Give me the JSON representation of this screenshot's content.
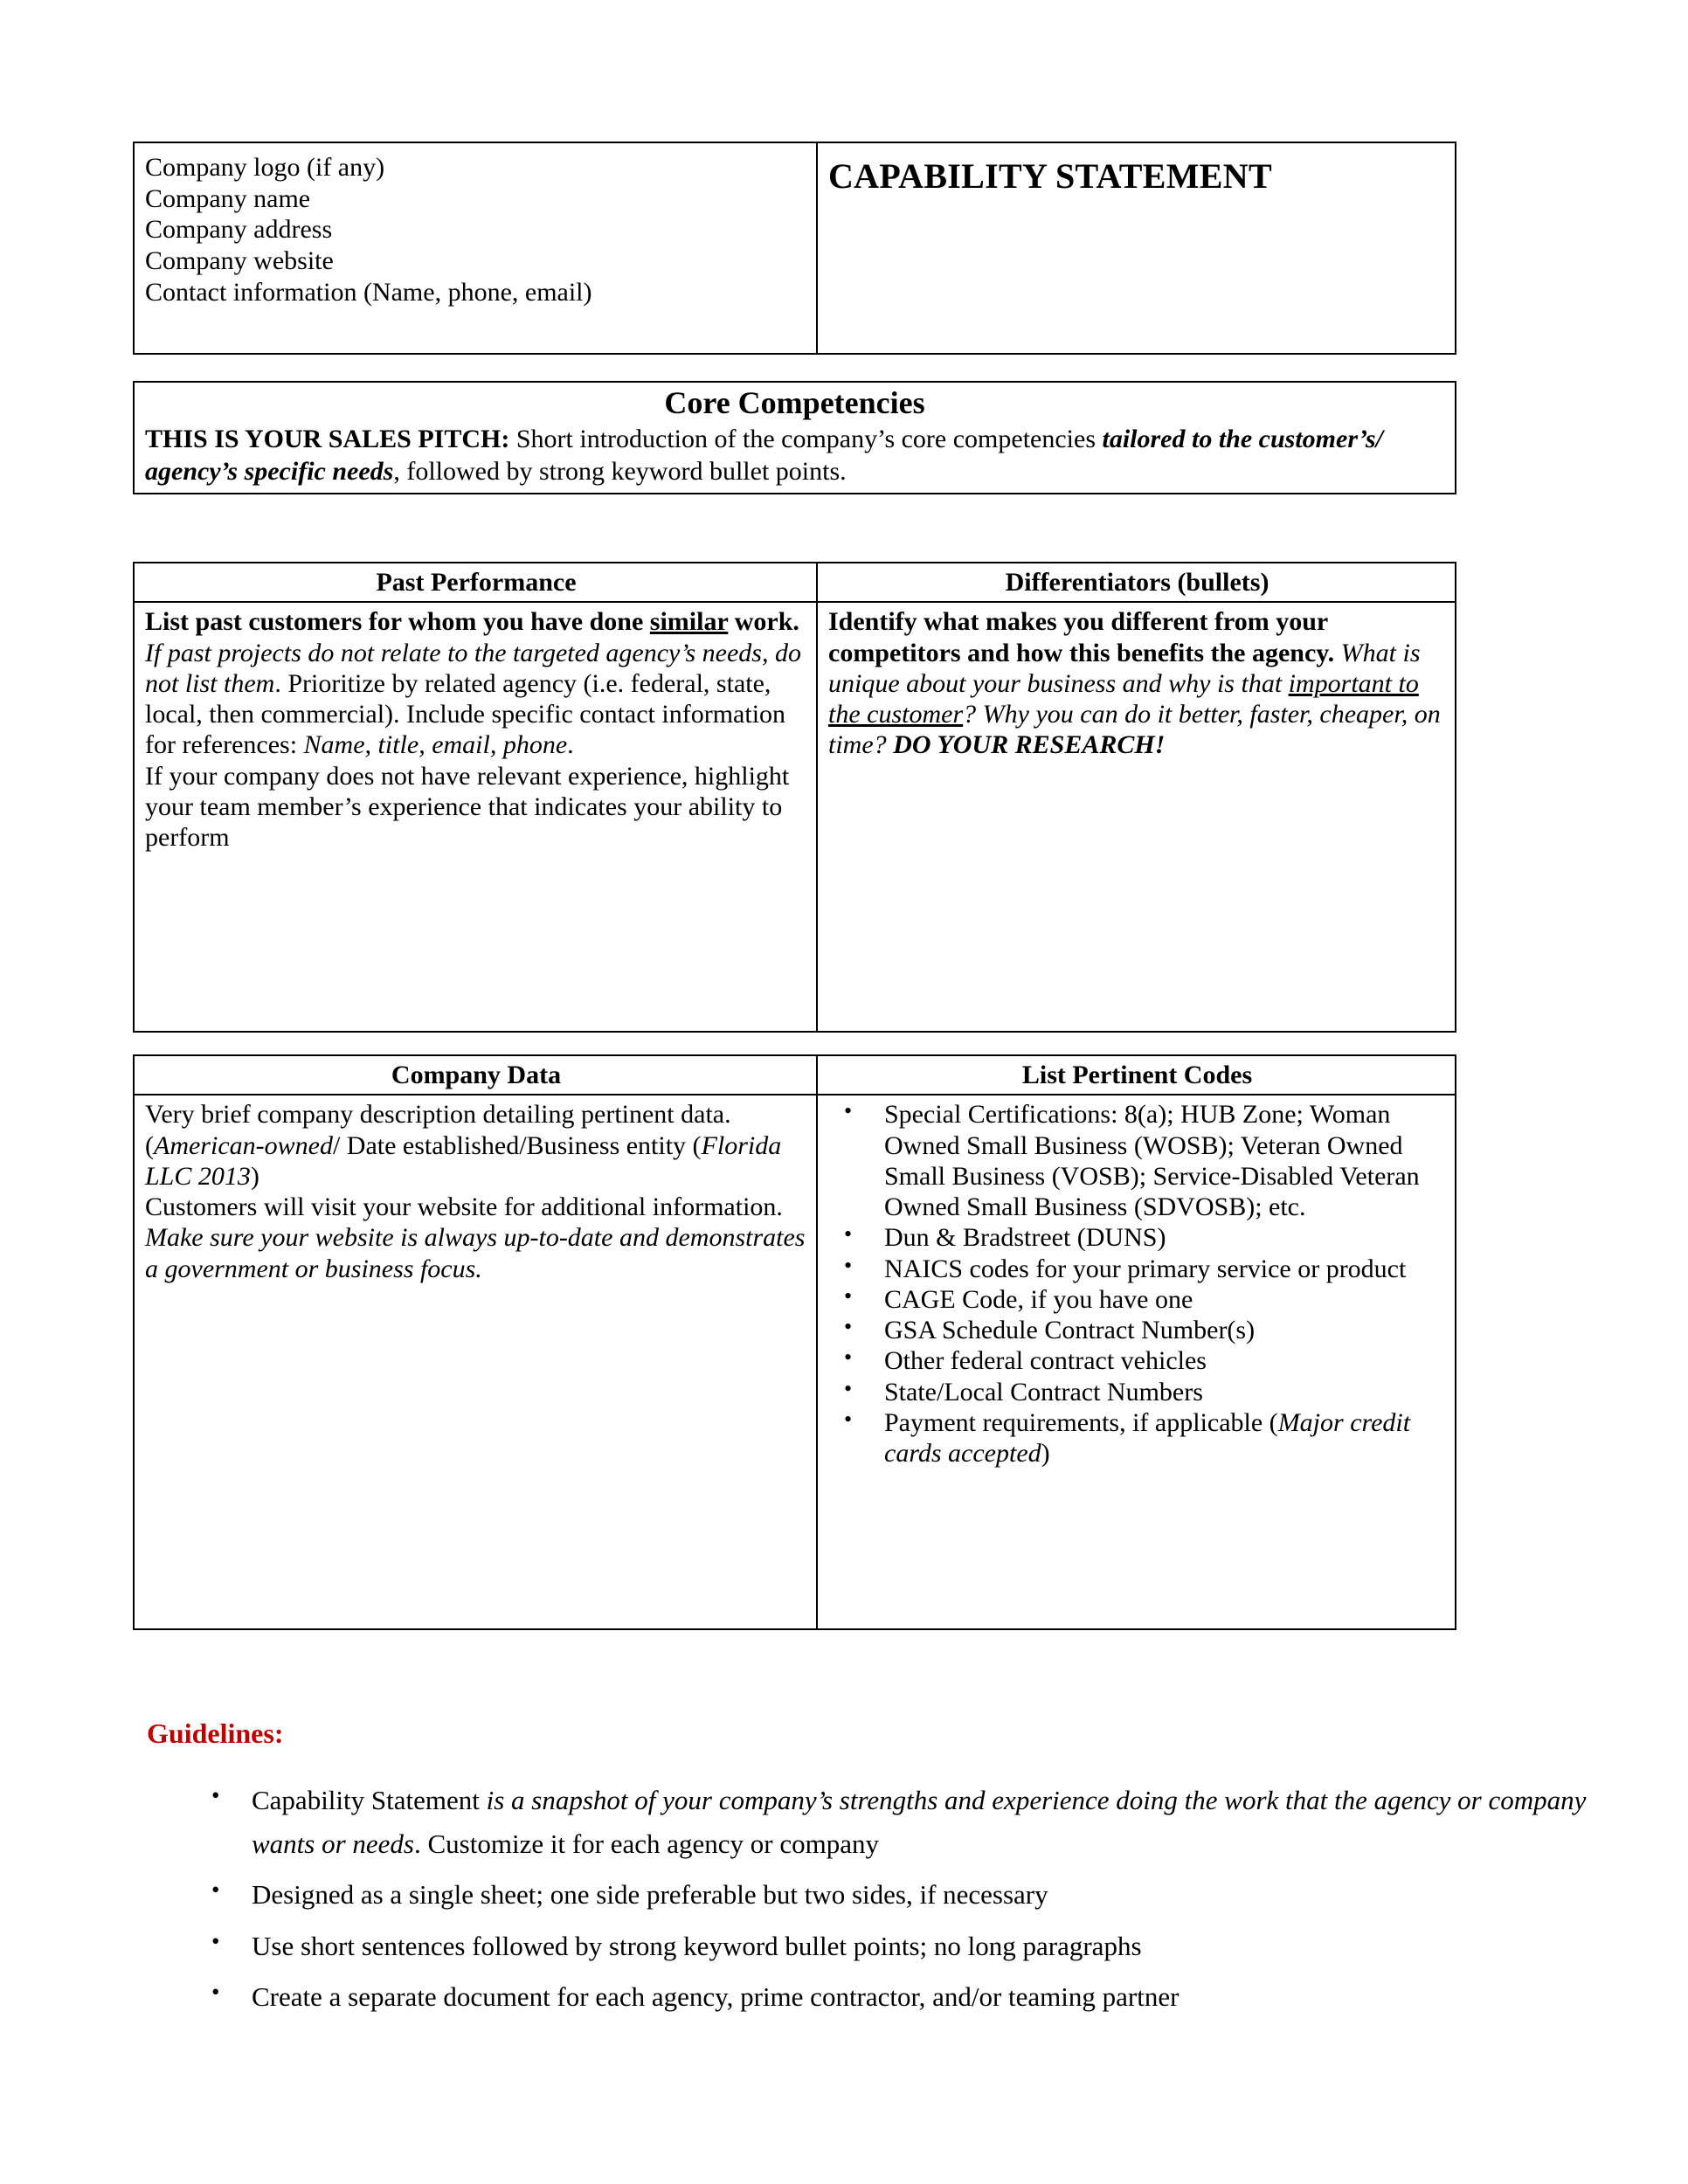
{
  "document": {
    "title": "CAPABILITY STATEMENT",
    "accent_color": "#C00000",
    "text_color": "#000000",
    "border_color": "#000000",
    "background": "#ffffff"
  },
  "header_table": {
    "identity_lines": [
      "Company logo (if any)",
      "Company name",
      "Company address",
      "Company website",
      "Contact information (Name, phone, email)"
    ],
    "title": "CAPABILITY STATEMENT"
  },
  "core_competencies": {
    "heading": "Core Competencies",
    "pitch_label": "THIS IS YOUR SALES PITCH:",
    "pitch_rest": " Short introduction of the company’s core competencies ",
    "pitch_emphasis": "tailored to the customer’s/ agency’s specific needs",
    "pitch_tail": ", followed by strong keyword bullet points."
  },
  "past_performance": {
    "heading": "Past Performance",
    "lead_bold_1": "List past customers for whom you have done ",
    "lead_bold_underline": "similar",
    "lead_bold_2": " work.",
    "italic_1": " If past projects do not relate to the targeted agency’s needs, do not list them",
    "plain_1": ". Prioritize by related agency (i.e. federal, state, local, then commercial). Include specific contact information for references: ",
    "italic_2": "Name, title, email, phone",
    "plain_2": ".",
    "paragraph_2": "If your company does not have relevant experience, highlight your team member’s experience that indicates your ability to perform"
  },
  "differentiators": {
    "heading": "Differentiators (bullets)",
    "lead_bold": "Identify what makes you different from your competitors and how this benefits the agency.",
    "italic_1": " What is unique about your business and why is that ",
    "italic_underline": "important to the customer",
    "italic_2": "? Why you can do it better, faster, cheaper, on time? ",
    "bold_italic": "DO YOUR RESEARCH!"
  },
  "company_data": {
    "heading": "Company Data",
    "p1_plain_1": "Very brief company description detailing pertinent data. (",
    "p1_italic_1": "American-owned",
    "p1_plain_2": "/ Date established/Business entity (",
    "p1_italic_2": "Florida LLC 2013",
    "p1_plain_3": ")",
    "p2_plain": "Customers will visit your website for additional information. ",
    "p2_italic": "Make sure your website is always up-to-date and demonstrates a government or business focus."
  },
  "pertinent_codes": {
    "heading": "List Pertinent Codes",
    "items": [
      {
        "text": "Special Certifications: 8(a);  HUB Zone; Woman Owned Small Business (WOSB); Veteran Owned Small Business (VOSB); Service-Disabled Veteran Owned Small Business (SDVOSB); etc.",
        "italic_tail": ""
      },
      {
        "text": "Dun  & Bradstreet (DUNS)",
        "italic_tail": ""
      },
      {
        "text": "NAICS codes for your primary service or product",
        "italic_tail": ""
      },
      {
        "text": "CAGE Code, if you have one",
        "italic_tail": ""
      },
      {
        "text": "GSA Schedule Contract Number(s)",
        "italic_tail": ""
      },
      {
        "text": "Other federal contract vehicles",
        "italic_tail": ""
      },
      {
        "text": "State/Local Contract Numbers",
        "italic_tail": ""
      },
      {
        "text": "Payment requirements, if applicable (",
        "italic_tail": "Major credit cards accepted",
        "text_close": ")"
      }
    ]
  },
  "guidelines": {
    "heading": "Guidelines:",
    "items": [
      {
        "plain_1": "Capability Statement ",
        "italic_1": "is a snapshot of your company’s strengths and experience doing the work that the agency or company wants or needs",
        "plain_2": ". Customize it for each agency or company"
      },
      {
        "plain_1": "Designed as a single sheet;  one side preferable but two sides, if necessary",
        "italic_1": "",
        "plain_2": ""
      },
      {
        "plain_1": "Use short sentences followed by strong keyword bullet points; no long paragraphs",
        "italic_1": "",
        "plain_2": ""
      },
      {
        "plain_1": "Create a separate document for each agency, prime contractor, and/or teaming partner",
        "italic_1": "",
        "plain_2": ""
      }
    ]
  }
}
